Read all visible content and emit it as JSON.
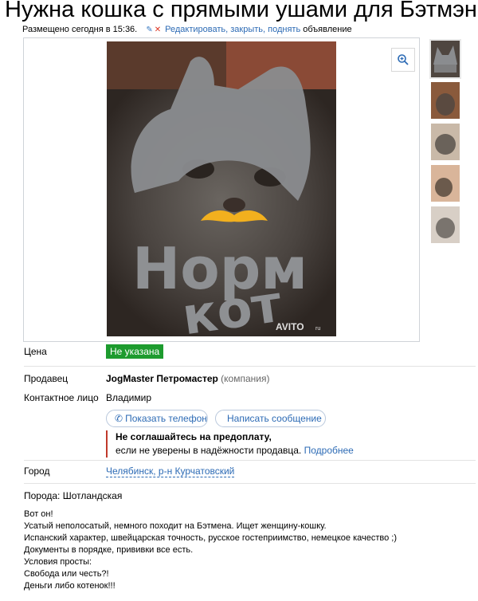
{
  "title": "Нужна кошка с прямыми ушами для Бэтмэна",
  "meta": {
    "posted": "Размещено сегодня в 15:36.",
    "edit_link": "Редактировать, закрыть, поднять",
    "edit_suffix": "объявление"
  },
  "image": {
    "watermark_line1": "Норм",
    "watermark_line2": "кот",
    "avito": "AVITO",
    "avito_suffix": "ru"
  },
  "thumbnails": [
    "thumb-1",
    "thumb-2",
    "thumb-3",
    "thumb-4",
    "thumb-5"
  ],
  "price": {
    "label": "Цена",
    "value": "Не указана"
  },
  "seller": {
    "label": "Продавец",
    "name": "JogMaster Петромастер",
    "type": "(компания)"
  },
  "contact": {
    "label": "Контактное лицо",
    "name": "Владимир"
  },
  "buttons": {
    "phone": "Показать телефон",
    "message": "Написать сообщение"
  },
  "warning": {
    "bold": "Не соглашайтесь на предоплату,",
    "text": "если не уверены в надёжности продавца.",
    "link": "Подробнее"
  },
  "city": {
    "label": "Город",
    "value": "Челябинск, р-н Курчатовский"
  },
  "breed": "Порода: Шотландская",
  "description": [
    "Вот он!",
    "Усатый неполосатый, немного походит на Бэтмена. Ищет женщину-кошку.",
    "Испанский характер, швейцарская точность, русское гостеприимство, немецкое качество ;)",
    "Документы в порядке, прививки все есть.",
    "Условия просты:",
    "Свобода или честь?!",
    "Деньги либо котенок!!!"
  ],
  "colors": {
    "accent": "#2d6bb5",
    "price_badge": "#1d9b2e",
    "warning_bar": "#c0392b"
  }
}
